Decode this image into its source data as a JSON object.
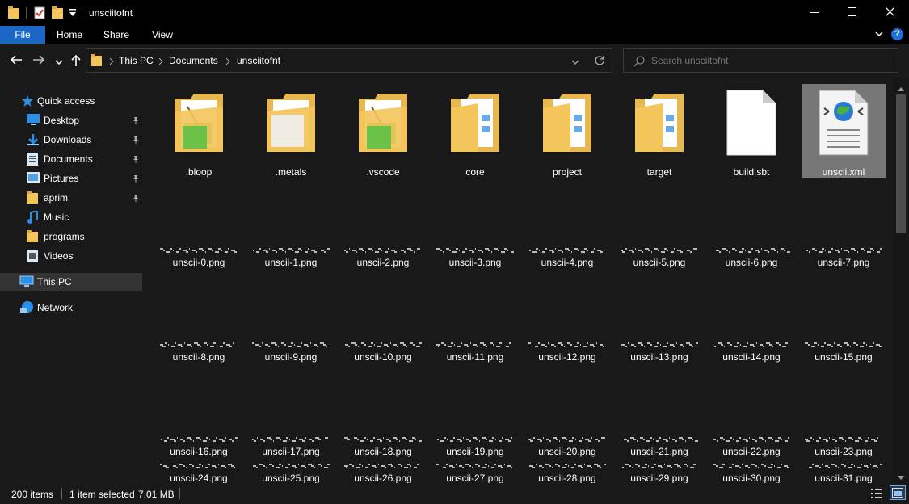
{
  "window": {
    "title": "unsciitofnt",
    "minimize_icon": "minimize-icon",
    "maximize_icon": "maximize-icon",
    "close_icon": "close-icon"
  },
  "ribbon": {
    "tabs": [
      "File",
      "Home",
      "Share",
      "View"
    ],
    "help": "?"
  },
  "address": {
    "crumbs": [
      "This PC",
      "Documents",
      "unsciitofnt"
    ]
  },
  "search": {
    "placeholder": "Search unsciitofnt"
  },
  "sidebar": {
    "quick_access": "Quick access",
    "items": [
      {
        "label": "Desktop",
        "icon": "desktop-icon",
        "pinned": true
      },
      {
        "label": "Downloads",
        "icon": "downloads-icon",
        "pinned": true
      },
      {
        "label": "Documents",
        "icon": "documents-icon",
        "pinned": true
      },
      {
        "label": "Pictures",
        "icon": "pictures-icon",
        "pinned": true
      },
      {
        "label": "aprim",
        "icon": "folder-icon",
        "pinned": true
      },
      {
        "label": "Music",
        "icon": "music-icon",
        "pinned": false
      },
      {
        "label": "programs",
        "icon": "folder-icon",
        "pinned": false
      },
      {
        "label": "Videos",
        "icon": "videos-icon",
        "pinned": false
      }
    ],
    "this_pc": "This PC",
    "network": "Network"
  },
  "files": {
    "row1": [
      {
        "name": ".bloop",
        "kind": "folder-app"
      },
      {
        "name": ".metals",
        "kind": "folder-gear"
      },
      {
        "name": ".vscode",
        "kind": "folder-app"
      },
      {
        "name": "core",
        "kind": "folder-doc"
      },
      {
        "name": "project",
        "kind": "folder-doc"
      },
      {
        "name": "target",
        "kind": "folder-doc"
      },
      {
        "name": "build.sbt",
        "kind": "file"
      },
      {
        "name": "unscii.xml",
        "kind": "xml",
        "selected": true
      }
    ],
    "png_rows": [
      [
        "unscii-0.png",
        "unscii-1.png",
        "unscii-2.png",
        "unscii-3.png",
        "unscii-4.png",
        "unscii-5.png",
        "unscii-6.png",
        "unscii-7.png"
      ],
      [
        "unscii-8.png",
        "unscii-9.png",
        "unscii-10.png",
        "unscii-11.png",
        "unscii-12.png",
        "unscii-13.png",
        "unscii-14.png",
        "unscii-15.png"
      ],
      [
        "unscii-16.png",
        "unscii-17.png",
        "unscii-18.png",
        "unscii-19.png",
        "unscii-20.png",
        "unscii-21.png",
        "unscii-22.png",
        "unscii-23.png"
      ],
      [
        "unscii-24.png",
        "unscii-25.png",
        "unscii-26.png",
        "unscii-27.png",
        "unscii-28.png",
        "unscii-29.png",
        "unscii-30.png",
        "unscii-31.png"
      ]
    ]
  },
  "status": {
    "count": "200 items",
    "selection": "1 item selected",
    "size": "7.01 MB"
  },
  "colors": {
    "accent": "#1a66c4",
    "folder": "#f3c55b",
    "selected": "#777777"
  }
}
